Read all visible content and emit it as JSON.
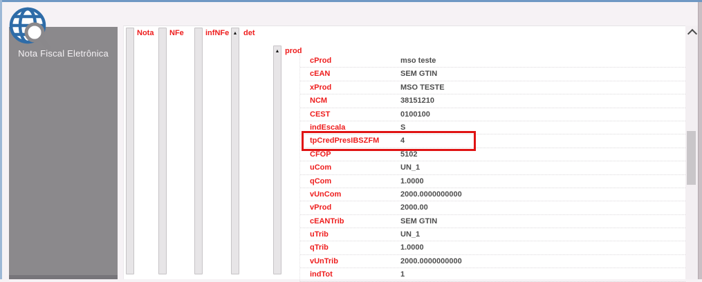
{
  "window": {
    "app_label": "Nota Fiscal Eletrônica"
  },
  "sidebar": {
    "label": "Nota Fiscal Eletrônica",
    "logo_icon": "globe-with-magnifier-icon"
  },
  "tree": {
    "levels": [
      {
        "label": "Nota",
        "collapse_icon": null
      },
      {
        "label": "NFe",
        "collapse_icon": null
      },
      {
        "label": "infNFe",
        "collapse_icon": null
      },
      {
        "label": "det",
        "collapse_icon": "triangle-up"
      },
      {
        "label": "prod",
        "collapse_icon": "triangle-up"
      }
    ],
    "collapse_glyph": "▲",
    "fields": [
      {
        "name": "cProd",
        "value": "mso teste",
        "highlighted": false
      },
      {
        "name": "cEAN",
        "value": "SEM GTIN",
        "highlighted": false
      },
      {
        "name": "xProd",
        "value": "MSO TESTE",
        "highlighted": false
      },
      {
        "name": "NCM",
        "value": "38151210",
        "highlighted": false
      },
      {
        "name": "CEST",
        "value": "0100100",
        "highlighted": false
      },
      {
        "name": "indEscala",
        "value": "S",
        "highlighted": false
      },
      {
        "name": "tpCredPresIBSZFM",
        "value": "4",
        "highlighted": true
      },
      {
        "name": "CFOP",
        "value": "5102",
        "highlighted": false
      },
      {
        "name": "uCom",
        "value": "UN_1",
        "highlighted": false
      },
      {
        "name": "qCom",
        "value": "1.0000",
        "highlighted": false
      },
      {
        "name": "vUnCom",
        "value": "2000.0000000000",
        "highlighted": false
      },
      {
        "name": "vProd",
        "value": "2000.00",
        "highlighted": false
      },
      {
        "name": "cEANTrib",
        "value": "SEM GTIN",
        "highlighted": false
      },
      {
        "name": "uTrib",
        "value": "UN_1",
        "highlighted": false
      },
      {
        "name": "qTrib",
        "value": "1.0000",
        "highlighted": false
      },
      {
        "name": "vUnTrib",
        "value": "2000.0000000000",
        "highlighted": false
      },
      {
        "name": "indTot",
        "value": "1",
        "highlighted": false
      }
    ]
  },
  "annotation": {
    "highlight_color": "#e01313",
    "highlighted_field": "tpCredPresIBSZFM"
  },
  "colors": {
    "field_name_red": "#ee1c1c",
    "value_gray": "#4d4d4d",
    "sidebar_gray": "#8b898c",
    "globe_blue": "#2e6ca8",
    "window_border_blue": "#6f98c4"
  },
  "scrollbar": {
    "up_icon": "chevron-up",
    "thumb_visible": true
  }
}
